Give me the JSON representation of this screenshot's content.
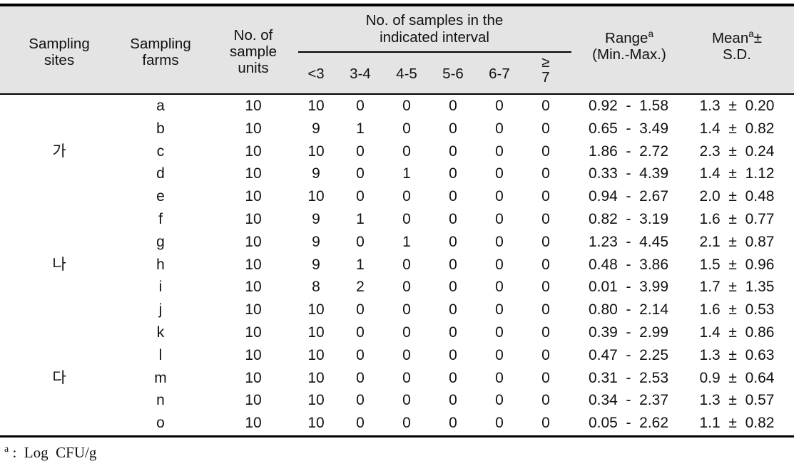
{
  "table": {
    "header": {
      "sampling_sites": [
        "Sampling",
        "sites"
      ],
      "sampling_farms": [
        "Sampling",
        "farms"
      ],
      "sample_units": [
        "No. of",
        "sample",
        "units"
      ],
      "group_title": [
        "No. of   samples  in  the",
        "indicated  interval"
      ],
      "intervals": [
        "<3",
        "3-4",
        "4-5",
        "5-6",
        "6-7",
        "≥ 7"
      ],
      "interval_ge7_top": "≥",
      "interval_ge7_bottom": "7",
      "range_label": "Range",
      "range_sup": "a",
      "range_sub": "(Min.-Max.)",
      "mean_label": "Mean",
      "mean_sup": "a",
      "mean_pm": "±",
      "mean_sub": "S.D."
    },
    "rows": [
      {
        "site": "",
        "farm": "a",
        "units": "10",
        "iv": [
          "10",
          "0",
          "0",
          "0",
          "0",
          "0"
        ],
        "range": "0.92  -  1.58",
        "mean": "1.3  ±  0.20"
      },
      {
        "site": "",
        "farm": "b",
        "units": "10",
        "iv": [
          "9",
          "1",
          "0",
          "0",
          "0",
          "0"
        ],
        "range": "0.65  -  3.49",
        "mean": "1.4  ±  0.82"
      },
      {
        "site": "가",
        "farm": "c",
        "units": "10",
        "iv": [
          "10",
          "0",
          "0",
          "0",
          "0",
          "0"
        ],
        "range": "1.86  -  2.72",
        "mean": "2.3  ±  0.24"
      },
      {
        "site": "",
        "farm": "d",
        "units": "10",
        "iv": [
          "9",
          "0",
          "1",
          "0",
          "0",
          "0"
        ],
        "range": "0.33  -  4.39",
        "mean": "1.4  ±  1.12"
      },
      {
        "site": "",
        "farm": "e",
        "units": "10",
        "iv": [
          "10",
          "0",
          "0",
          "0",
          "0",
          "0"
        ],
        "range": "0.94  -  2.67",
        "mean": "2.0  ±  0.48"
      },
      {
        "site": "",
        "farm": "f",
        "units": "10",
        "iv": [
          "9",
          "1",
          "0",
          "0",
          "0",
          "0"
        ],
        "range": "0.82  -  3.19",
        "mean": "1.6  ±  0.77"
      },
      {
        "site": "",
        "farm": "g",
        "units": "10",
        "iv": [
          "9",
          "0",
          "1",
          "0",
          "0",
          "0"
        ],
        "range": "1.23  -  4.45",
        "mean": "2.1  ±  0.87"
      },
      {
        "site": "나",
        "farm": "h",
        "units": "10",
        "iv": [
          "9",
          "1",
          "0",
          "0",
          "0",
          "0"
        ],
        "range": "0.48  -  3.86",
        "mean": "1.5  ±  0.96"
      },
      {
        "site": "",
        "farm": "i",
        "units": "10",
        "iv": [
          "8",
          "2",
          "0",
          "0",
          "0",
          "0"
        ],
        "range": "0.01  -  3.99",
        "mean": "1.7  ±  1.35"
      },
      {
        "site": "",
        "farm": "j",
        "units": "10",
        "iv": [
          "10",
          "0",
          "0",
          "0",
          "0",
          "0"
        ],
        "range": "0.80  -  2.14",
        "mean": "1.6  ±  0.53"
      },
      {
        "site": "",
        "farm": "k",
        "units": "10",
        "iv": [
          "10",
          "0",
          "0",
          "0",
          "0",
          "0"
        ],
        "range": "0.39  -  2.99",
        "mean": "1.4  ±  0.86"
      },
      {
        "site": "",
        "farm": "l",
        "units": "10",
        "iv": [
          "10",
          "0",
          "0",
          "0",
          "0",
          "0"
        ],
        "range": "0.47  -  2.25",
        "mean": "1.3  ±  0.63"
      },
      {
        "site": "다",
        "farm": "m",
        "units": "10",
        "iv": [
          "10",
          "0",
          "0",
          "0",
          "0",
          "0"
        ],
        "range": "0.31  -  2.53",
        "mean": "0.9  ±  0.64"
      },
      {
        "site": "",
        "farm": "n",
        "units": "10",
        "iv": [
          "10",
          "0",
          "0",
          "0",
          "0",
          "0"
        ],
        "range": "0.34  -  2.37",
        "mean": "1.3  ±  0.57"
      },
      {
        "site": "",
        "farm": "o",
        "units": "10",
        "iv": [
          "10",
          "0",
          "0",
          "0",
          "0",
          "0"
        ],
        "range": "0.05  -  2.62",
        "mean": "1.1  ±  0.82"
      }
    ],
    "footnote": {
      "marker": "a",
      "text": " :  Log  CFU/g"
    },
    "colors": {
      "header_background": "#e4e4e4",
      "rule": "#000000",
      "text": "#111111",
      "page_background": "#ffffff"
    }
  }
}
